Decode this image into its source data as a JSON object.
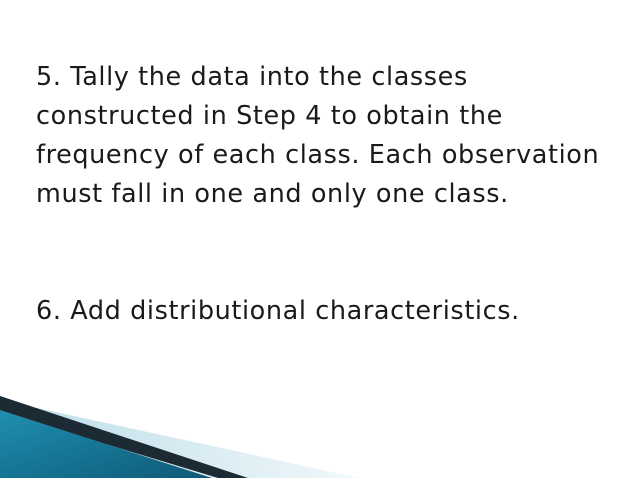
{
  "slide": {
    "paragraphs": [
      "5. Tally the data into the classes constructed in Step 4 to obtain the frequency of each class. Each observation must fall in one and only one class.",
      "6. Add distributional characteristics."
    ],
    "colors": {
      "text": "#1a1a1a",
      "background": "#ffffff",
      "accent_teal": "#1f8fb0",
      "accent_dark": "#1b2a33",
      "accent_light": "#cfe7ef"
    }
  }
}
